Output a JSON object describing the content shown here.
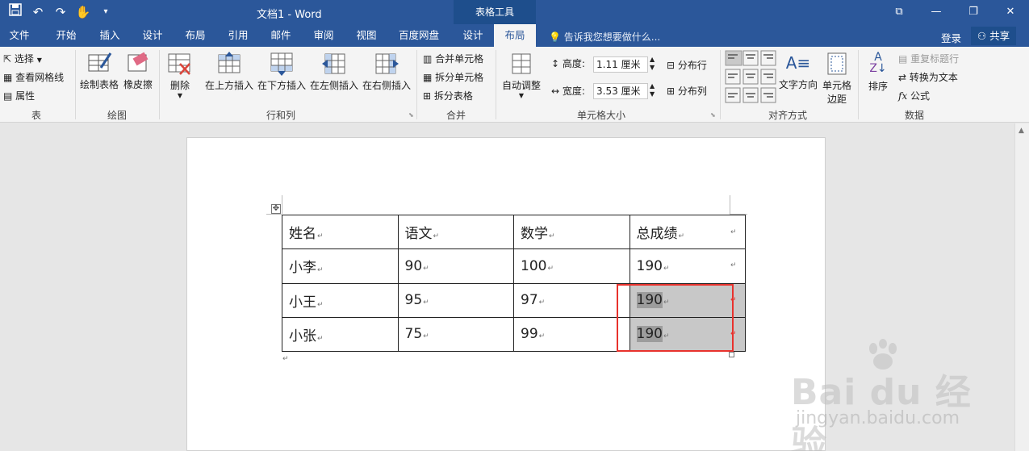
{
  "titlebar": {
    "doc_title": "文档1 - Word",
    "context_tools": "表格工具",
    "qat_icons": [
      "save-icon",
      "undo-icon",
      "redo-icon",
      "touch-mode-icon",
      "customize-qat-icon"
    ],
    "window_icons": [
      "ribbon-display-icon",
      "minimize-icon",
      "restore-icon",
      "close-icon"
    ]
  },
  "tabs": [
    {
      "label": "文件"
    },
    {
      "label": "开始"
    },
    {
      "label": "插入"
    },
    {
      "label": "设计"
    },
    {
      "label": "布局"
    },
    {
      "label": "引用"
    },
    {
      "label": "邮件"
    },
    {
      "label": "审阅"
    },
    {
      "label": "视图"
    },
    {
      "label": "百度网盘"
    },
    {
      "label": "设计"
    },
    {
      "label": "布局"
    }
  ],
  "tell_me": "告诉我您想要做什么...",
  "login": "登录",
  "share": "共享",
  "ribbon": {
    "table_group": {
      "select": "选择",
      "gridlines": "查看网格线",
      "properties": "属性",
      "label": "表"
    },
    "draw_group": {
      "draw_table": "绘制表格",
      "eraser": "橡皮擦",
      "label": "绘图"
    },
    "rows_cols_group": {
      "delete": "删除",
      "insert_above": "在上方插入",
      "insert_below": "在下方插入",
      "insert_left": "在左侧插入",
      "insert_right": "在右侧插入",
      "label": "行和列"
    },
    "merge_group": {
      "merge_cells": "合并单元格",
      "split_cells": "拆分单元格",
      "split_table": "拆分表格",
      "label": "合并"
    },
    "cell_size_group": {
      "autofit": "自动调整",
      "height_label": "高度:",
      "height_value": "1.11 厘米",
      "width_label": "宽度:",
      "width_value": "3.53 厘米",
      "distribute_rows": "分布行",
      "distribute_cols": "分布列",
      "label": "单元格大小"
    },
    "alignment_group": {
      "text_direction": "文字方向",
      "cell_margins_line1": "单元格",
      "cell_margins_line2": "边距",
      "label": "对齐方式"
    },
    "data_group": {
      "sort": "排序",
      "repeat_header": "重复标题行",
      "convert_text": "转换为文本",
      "formula": "公式",
      "label": "数据"
    }
  },
  "document": {
    "table": {
      "headers": [
        "姓名",
        "语文",
        "数学",
        "总成绩"
      ],
      "rows": [
        [
          "小李",
          "90",
          "100",
          "190"
        ],
        [
          "小王",
          "95",
          "97",
          "190"
        ],
        [
          "小张",
          "75",
          "99",
          "190"
        ]
      ]
    },
    "paragraph_mark": "↵"
  },
  "watermark": {
    "brand": "Bai du 经验",
    "url": "jingyan.baidu.com"
  },
  "colors": {
    "brand_blue": "#2b579a",
    "context_tab": "#1e4e8c",
    "selection_border": "#e8322d",
    "cell_selection": "#c8c8c8"
  }
}
